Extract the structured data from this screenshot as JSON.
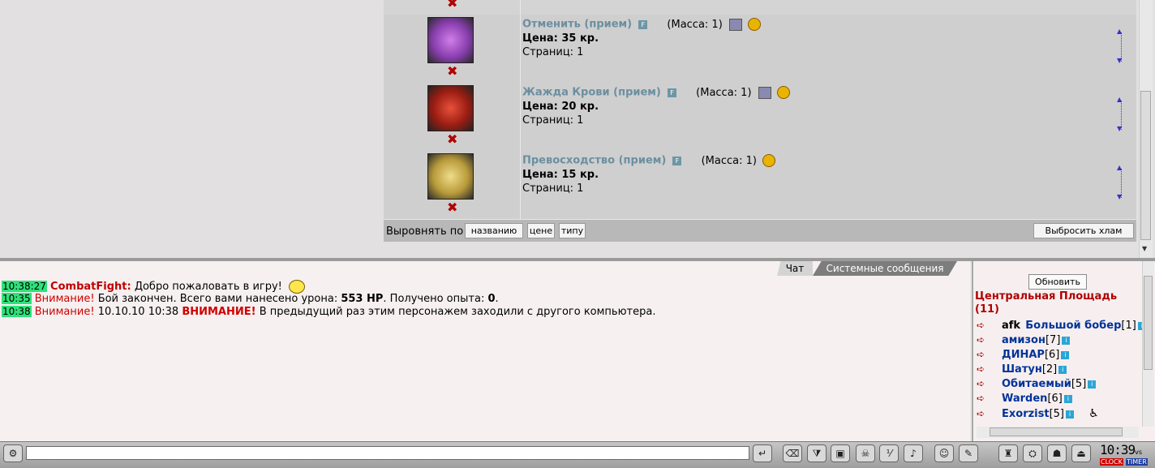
{
  "inventory": {
    "items": [
      {
        "name": "Отменить (прием)",
        "badge": "F",
        "mass": "(Масса: 1)",
        "price": "Цена: 35 кр.",
        "pages": "Страниц: 1",
        "has_box_icon": true,
        "img_color": "#8a3fb0"
      },
      {
        "name": "Жажда Крови (прием)",
        "badge": "F",
        "mass": "(Масса: 1)",
        "price": "Цена: 20 кр.",
        "pages": "Страниц: 1",
        "has_box_icon": true,
        "img_color": "#9a1d12"
      },
      {
        "name": "Превосходство (прием)",
        "badge": "F",
        "mass": "(Масса: 1)",
        "price": "Цена: 15 кр.",
        "pages": "Страниц: 1",
        "has_box_icon": false,
        "img_color": "#b89a3a"
      }
    ],
    "delete_glyph": "✖",
    "sort_label": "Выровнять по",
    "sort_by_name": "названию",
    "sort_by_price": "цене",
    "sort_by_type": "типу",
    "drop_junk": "Выбросить хлам"
  },
  "chat": {
    "tabs": {
      "chat": "Чат",
      "system": "Системные сообщения"
    },
    "messages": [
      {
        "time": "10:38:27",
        "sender": "CombatFight:",
        "text": "Добро пожаловать в игру!"
      },
      {
        "time": "10:35",
        "label": "Внимание!",
        "text_a": "Бой закончен. Всего вами нанесено урона:",
        "damage": "553 HP",
        "text_b": ". Получено опыта:",
        "exp": "0",
        "text_c": "."
      },
      {
        "time": "10:38",
        "label": "Внимание!",
        "date": "10.10.10 10:38",
        "caps": "ВНИМАНИЕ!",
        "text": "В предыдущий раз этим персонажем заходили с другого компьютера."
      }
    ]
  },
  "online": {
    "refresh_label": "Обновить",
    "room": "Центральная Площадь (11)",
    "users": [
      {
        "afk": "afk",
        "name": "Большой бобер",
        "level": "[1]"
      },
      {
        "name": "амизон",
        "level": "[7]"
      },
      {
        "name": "ДИНАР",
        "level": "[6]"
      },
      {
        "name": "Шатун",
        "level": "[2]"
      },
      {
        "name": "Обитаемый",
        "level": "[5]"
      },
      {
        "name": "Warden",
        "level": "[6]"
      },
      {
        "name": "Exorzist",
        "level": "[5]"
      }
    ],
    "info_glyph": "i"
  },
  "clock": {
    "time": "10:39",
    "suffix": "vs",
    "clock_label": "CLOCK",
    "timer_label": "TIMER"
  }
}
